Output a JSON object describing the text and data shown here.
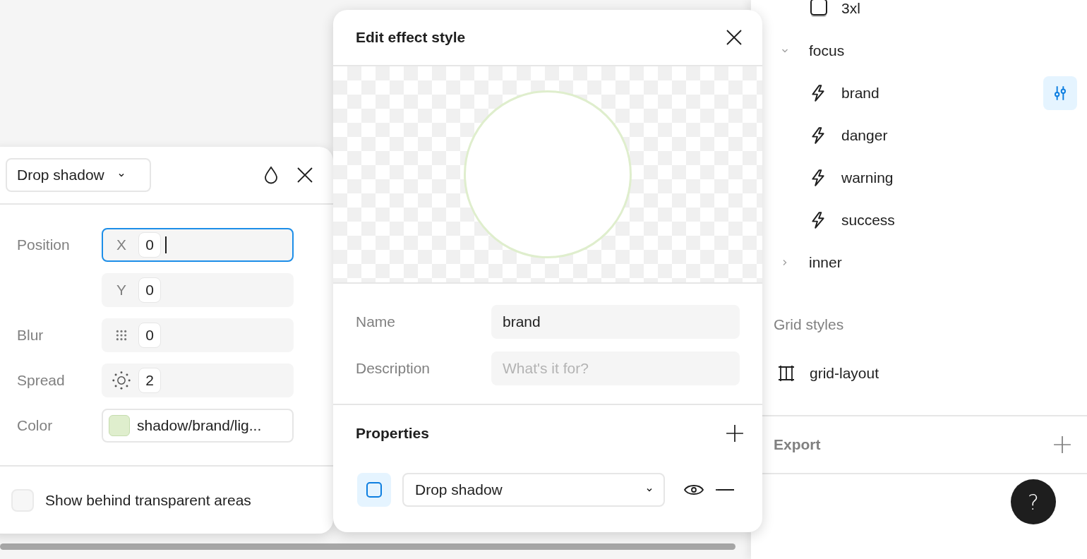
{
  "effect_panel": {
    "effect_type": "Drop shadow",
    "fields": [
      {
        "label": "Position",
        "kind": "axis",
        "prefix": "X",
        "value": "0",
        "focused": true
      },
      {
        "kind": "axis",
        "prefix": "Y",
        "value": "0",
        "focused": false
      },
      {
        "label": "Blur",
        "kind": "blur",
        "value": "0",
        "focused": false
      },
      {
        "label": "Spread",
        "kind": "spread",
        "value": "2",
        "focused": false
      }
    ],
    "color": {
      "label": "Color",
      "value": "shadow/brand/lig...",
      "color": "#dfeecd"
    },
    "behind_transparent": {
      "label": "Show behind transparent areas",
      "checked": false
    }
  },
  "modal": {
    "title": "Edit effect style",
    "name": {
      "label": "Name",
      "value": "brand"
    },
    "description": {
      "label": "Description",
      "placeholder": "What's it for?"
    },
    "properties": {
      "heading": "Properties",
      "effects": [
        {
          "type": "Drop shadow",
          "selected": true,
          "visible": true
        }
      ]
    }
  },
  "effect_styles": [
    {
      "label": "3xl",
      "kind": "shadow",
      "selected": false
    },
    {
      "label": "focus",
      "kind": "group",
      "expanded": true,
      "children": [
        {
          "label": "brand",
          "kind": "ring",
          "selected": true
        },
        {
          "label": "danger",
          "kind": "ring",
          "selected": false
        },
        {
          "label": "warning",
          "kind": "ring",
          "selected": false
        },
        {
          "label": "success",
          "kind": "ring",
          "selected": false
        }
      ]
    },
    {
      "label": "inner",
      "kind": "group",
      "expanded": false
    }
  ],
  "grid_styles": {
    "heading": "Grid styles",
    "items": [
      {
        "label": "grid-layout"
      }
    ]
  },
  "export": {
    "heading": "Export"
  },
  "help": {
    "label": "?"
  }
}
